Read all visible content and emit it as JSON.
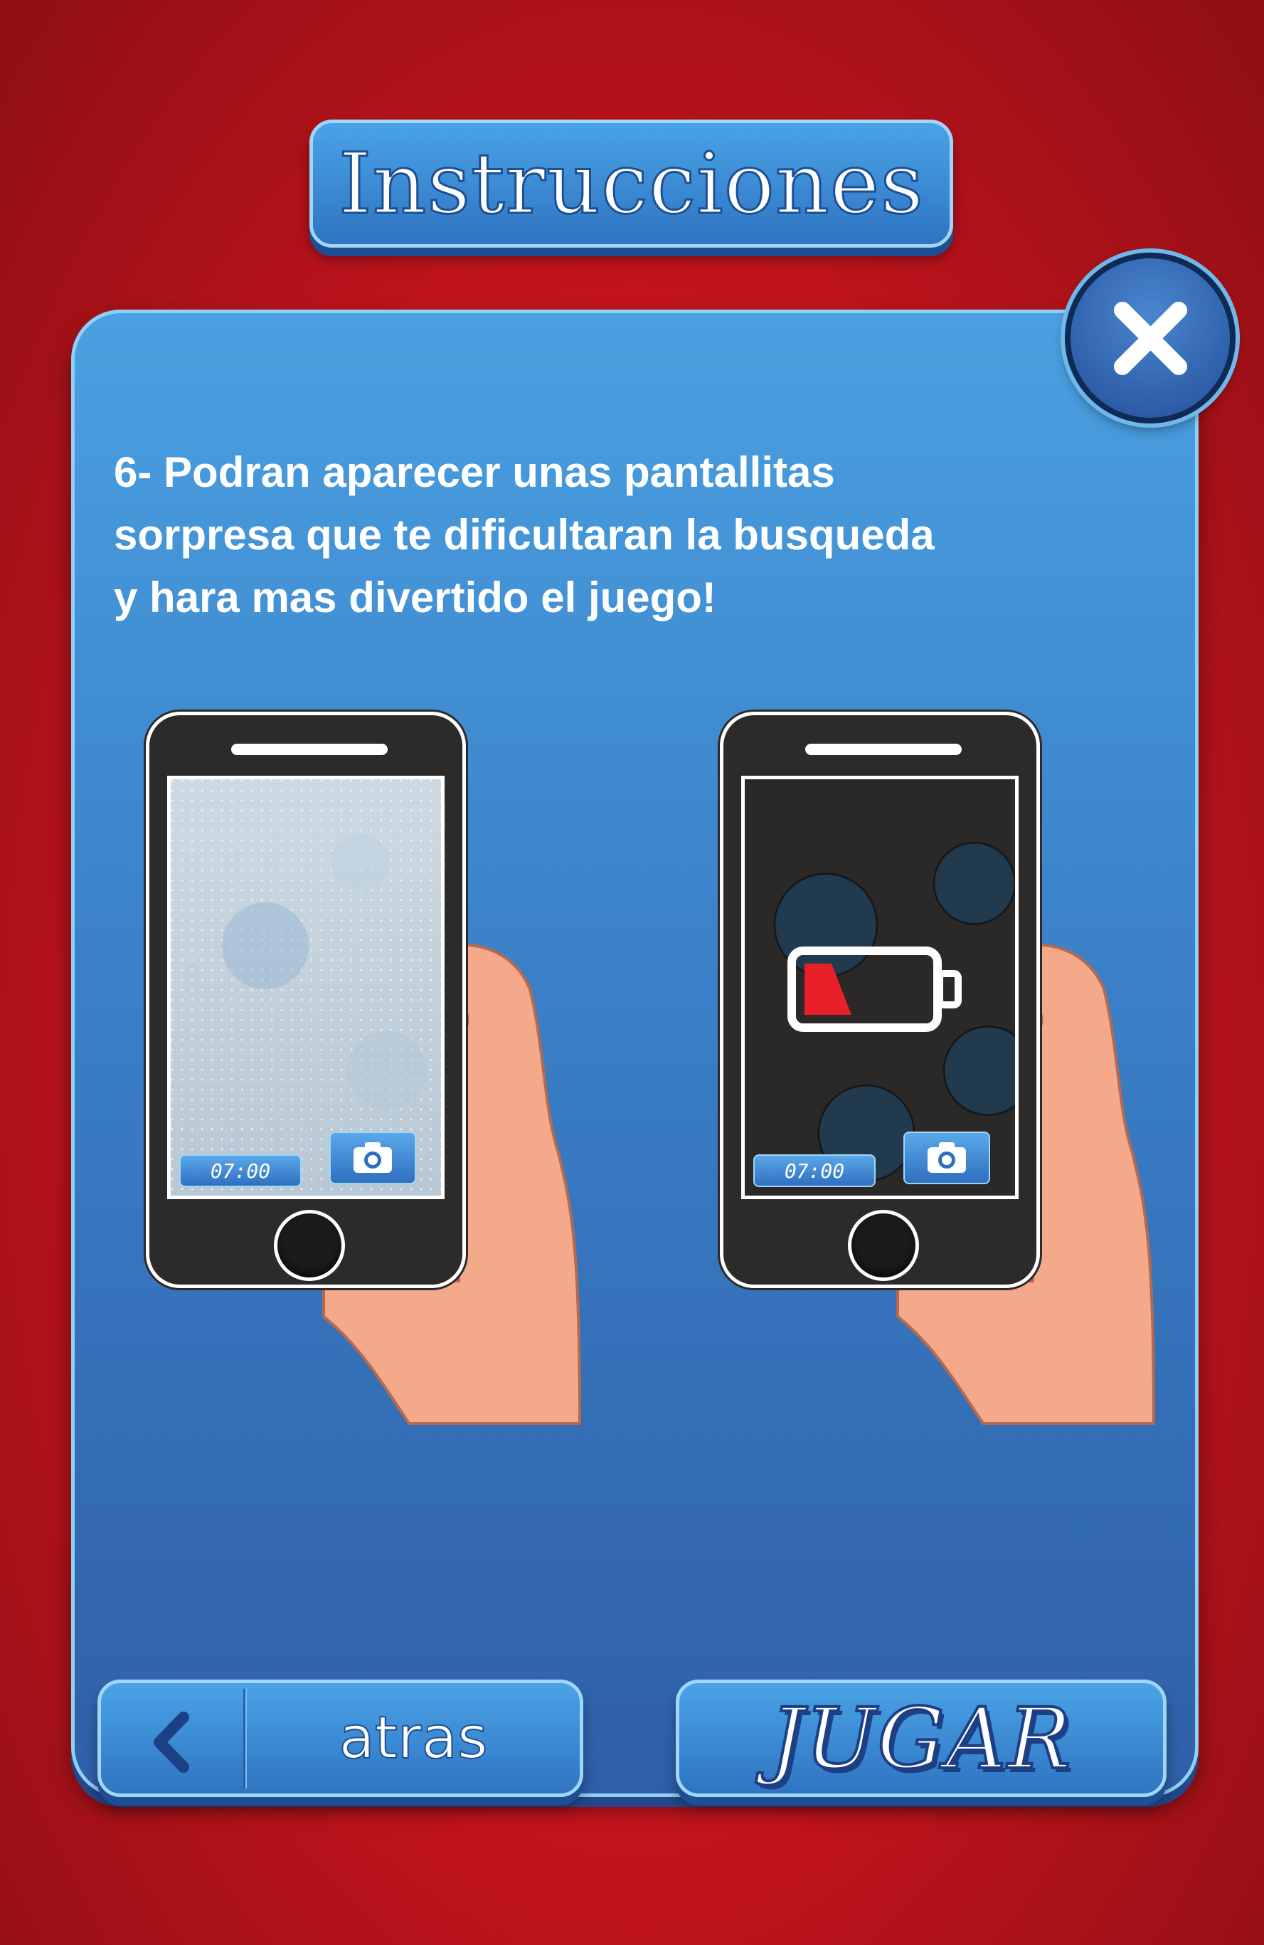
{
  "title": "Instrucciones",
  "instruction_text": "6- Podran aparecer unas pantallitas\nsorpresa que te  dificultaran la busqueda\ny hara mas divertido el juego!",
  "phones": [
    {
      "timer": "07:00",
      "overlay": "frost"
    },
    {
      "timer": "07:00",
      "overlay": "low-battery"
    }
  ],
  "back_button": {
    "label": "atras",
    "icon": "chevron-left-icon"
  },
  "play_button": {
    "label": "JUGAR"
  },
  "close_button": {
    "icon": "close-icon"
  },
  "colors": {
    "background": "#c8141e",
    "panel": "#3a80c8",
    "button": "#3a8ad6",
    "battery_low": "#e8202a",
    "skin": "#f3a98a"
  }
}
